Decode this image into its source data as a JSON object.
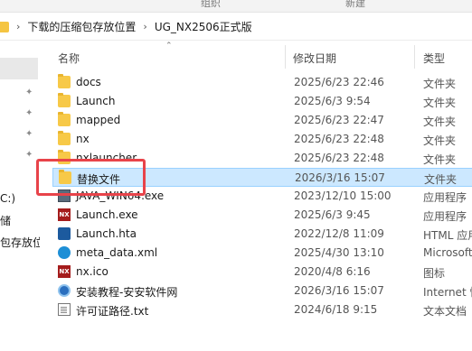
{
  "ribbon": {
    "group_label": "组织",
    "new_label": "新建"
  },
  "address": {
    "crumbs": [
      "下载的压缩包存放位置",
      "UG_NX2506正式版"
    ]
  },
  "nav": {
    "items": [
      "C:)",
      "储",
      "包存放位"
    ]
  },
  "columns": {
    "name": "名称",
    "date": "修改日期",
    "type": "类型"
  },
  "files": [
    {
      "name": "docs",
      "date": "2025/6/23 22:46",
      "type": "文件夹",
      "icon": "folder-icon"
    },
    {
      "name": "Launch",
      "date": "2025/6/3 9:54",
      "type": "文件夹",
      "icon": "folder-icon"
    },
    {
      "name": "mapped",
      "date": "2025/6/23 22:47",
      "type": "文件夹",
      "icon": "folder-icon"
    },
    {
      "name": "nx",
      "date": "2025/6/23 22:48",
      "type": "文件夹",
      "icon": "folder-icon"
    },
    {
      "name": "nxlauncher",
      "date": "2025/6/23 22:48",
      "type": "文件夹",
      "icon": "folder-icon"
    },
    {
      "name": "替换文件",
      "date": "2026/3/16 15:07",
      "type": "文件夹",
      "icon": "folder-icon",
      "selected": true
    },
    {
      "name": "JAVA_WIN64.exe",
      "date": "2023/12/10 15:00",
      "type": "应用程序",
      "icon": "exe-icon"
    },
    {
      "name": "Launch.exe",
      "date": "2025/6/3 9:45",
      "type": "应用程序",
      "icon": "nx-app-icon"
    },
    {
      "name": "Launch.hta",
      "date": "2022/12/8 11:09",
      "type": "HTML 应用",
      "icon": "hta-icon"
    },
    {
      "name": "meta_data.xml",
      "date": "2025/4/30 13:10",
      "type": "Microsoft",
      "icon": "edge-icon"
    },
    {
      "name": "nx.ico",
      "date": "2020/4/8 6:16",
      "type": "图标",
      "icon": "nx-app-icon"
    },
    {
      "name": "安装教程-安安软件网",
      "date": "2026/3/16 15:07",
      "type": "Internet 快",
      "icon": "globe-icon"
    },
    {
      "name": "许可证路径.txt",
      "date": "2024/6/18 9:15",
      "type": "文本文档",
      "icon": "text-file-icon"
    }
  ]
}
